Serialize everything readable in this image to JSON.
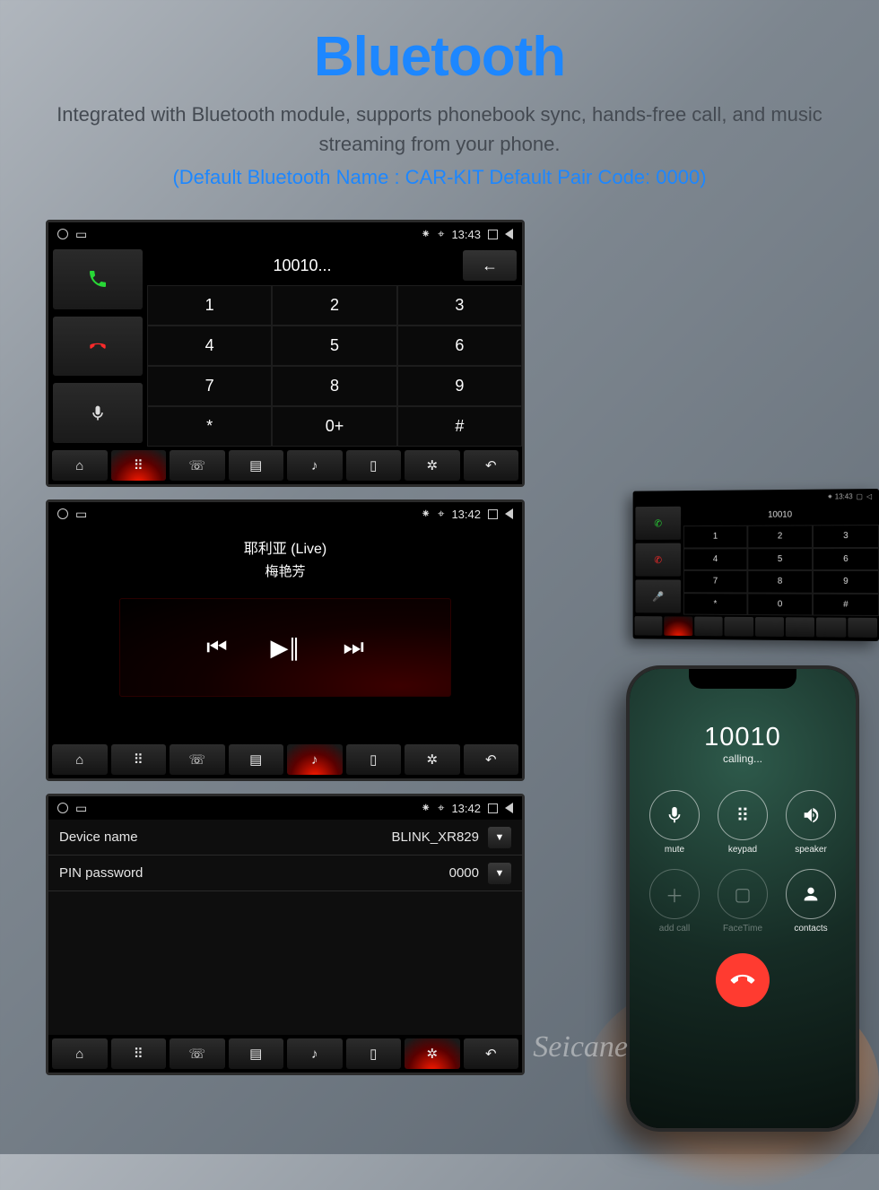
{
  "header": {
    "title": "Bluetooth",
    "subtitle": "Integrated with Bluetooth module, supports phonebook sync, hands-free call, and music streaming from your phone.",
    "defaults": "(Default Bluetooth Name : CAR-KIT   Default Pair Code: 0000)"
  },
  "status": {
    "time": "13:43",
    "time2": "13:42"
  },
  "dialpad": {
    "display": "10010...",
    "keys": [
      "1",
      "2",
      "3",
      "4",
      "5",
      "6",
      "7",
      "8",
      "9",
      "*",
      "0+",
      "#"
    ]
  },
  "music": {
    "track": "耶利亚 (Live)",
    "artist": "梅艳芳"
  },
  "settings": {
    "row1_label": "Device name",
    "row1_value": "BLINK_XR829",
    "row2_label": "PIN password",
    "row2_value": "0000"
  },
  "phone": {
    "number": "10010",
    "status": "calling...",
    "btns": {
      "mute": "mute",
      "keypad": "keypad",
      "speaker": "speaker",
      "addcall": "add call",
      "facetime": "FaceTime",
      "contacts": "contacts"
    }
  },
  "mount": {
    "display": "10010"
  },
  "watermark": "Seicane"
}
